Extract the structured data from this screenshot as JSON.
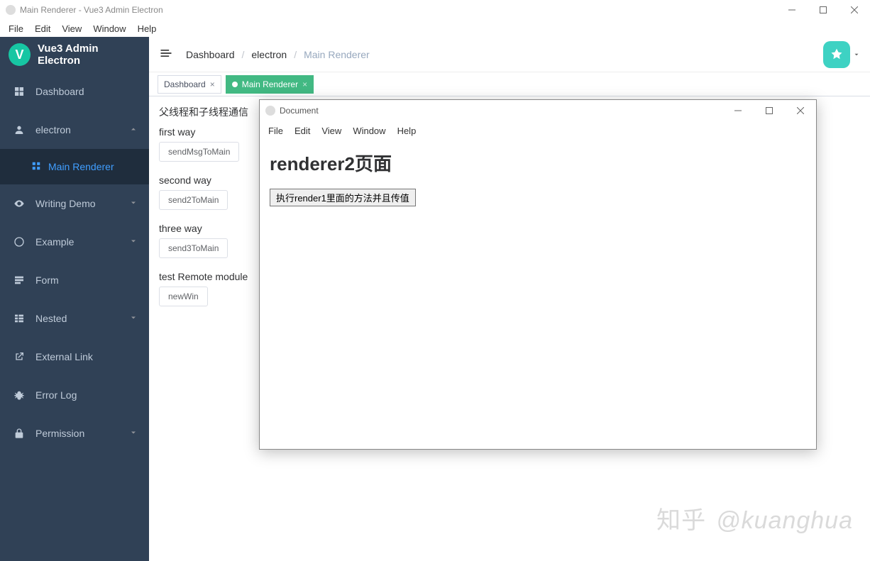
{
  "outerWindow": {
    "title": "Main Renderer - Vue3 Admin Electron"
  },
  "outerMenu": [
    "File",
    "Edit",
    "View",
    "Window",
    "Help"
  ],
  "sidebar": {
    "appTitle": "Vue3 Admin Electron",
    "logoLetter": "V",
    "items": [
      {
        "label": "Dashboard",
        "expandable": false
      },
      {
        "label": "electron",
        "expandable": true,
        "open": true,
        "children": [
          {
            "label": "Main Renderer",
            "active": true
          }
        ]
      },
      {
        "label": "Writing Demo",
        "expandable": true
      },
      {
        "label": "Example",
        "expandable": true
      },
      {
        "label": "Form",
        "expandable": false
      },
      {
        "label": "Nested",
        "expandable": true
      },
      {
        "label": "External Link",
        "expandable": false
      },
      {
        "label": "Error Log",
        "expandable": false
      },
      {
        "label": "Permission",
        "expandable": true
      }
    ]
  },
  "breadcrumb": [
    "Dashboard",
    "electron",
    "Main Renderer"
  ],
  "tabs": [
    {
      "label": "Dashboard",
      "active": false
    },
    {
      "label": "Main Renderer",
      "active": true
    }
  ],
  "content": {
    "heading": "父线程和子线程通信",
    "ways": [
      {
        "label": "first way",
        "button": "sendMsgToMain"
      },
      {
        "label": "second way",
        "button": "send2ToMain"
      },
      {
        "label": "three way",
        "button": "send3ToMain"
      },
      {
        "label": "test Remote module",
        "button": "newWin"
      }
    ]
  },
  "innerWindow": {
    "title": "Document",
    "menu": [
      "File",
      "Edit",
      "View",
      "Window",
      "Help"
    ],
    "heading": "renderer2页面",
    "button": "执行render1里面的方法并且传值"
  },
  "watermark": {
    "zh": "知乎",
    "handle": "@kuanghua"
  }
}
